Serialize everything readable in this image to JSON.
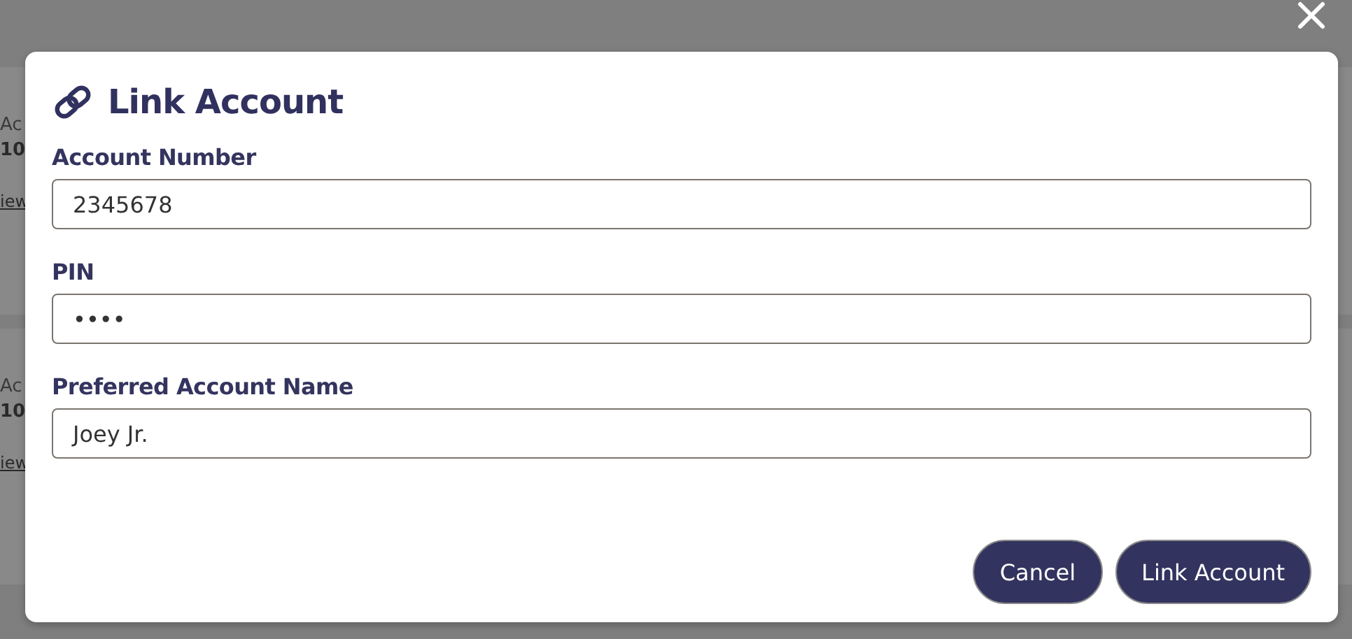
{
  "background_cards": [
    {
      "label": "Ac",
      "number": "10",
      "link": "iew"
    },
    {
      "label": "Ac",
      "number": "10",
      "link": "iew"
    }
  ],
  "dialog": {
    "title": "Link Account",
    "fields": [
      {
        "label": "Account Number",
        "value": "2345678"
      },
      {
        "label": "PIN",
        "value": "••••"
      },
      {
        "label": "Preferred Account Name",
        "value": "Joey Jr."
      }
    ],
    "buttons": [
      "Cancel",
      "Link Account"
    ]
  }
}
